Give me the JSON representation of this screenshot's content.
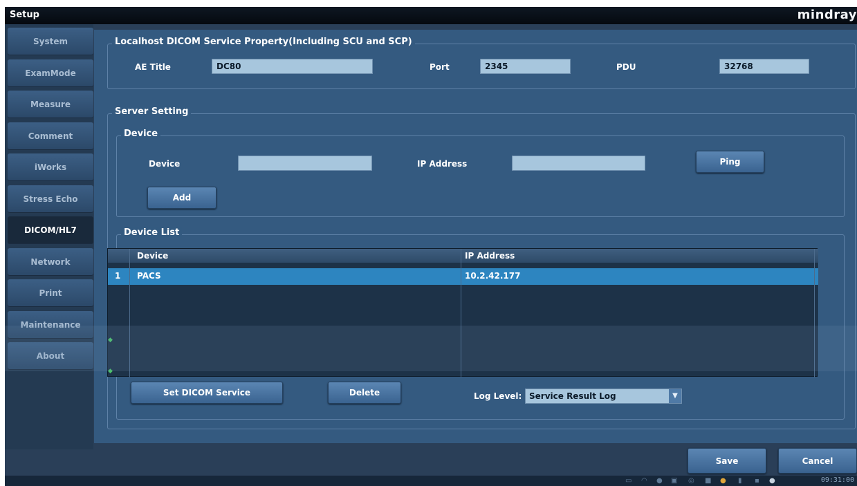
{
  "titlebar": {
    "title": "Setup",
    "brand": "mindray"
  },
  "sidebar": {
    "items": [
      {
        "label": "System"
      },
      {
        "label": "ExamMode"
      },
      {
        "label": "Measure"
      },
      {
        "label": "Comment"
      },
      {
        "label": "iWorks"
      },
      {
        "label": "Stress Echo"
      },
      {
        "label": "DICOM/HL7"
      },
      {
        "label": "Network"
      },
      {
        "label": "Print"
      },
      {
        "label": "Maintenance"
      },
      {
        "label": "About"
      }
    ],
    "active": "DICOM/HL7"
  },
  "localhost": {
    "legend": "Localhost DICOM Service Property(Including SCU and SCP)",
    "ae_title_label": "AE Title",
    "ae_title_value": "DC80",
    "port_label": "Port",
    "port_value": "2345",
    "pdu_label": "PDU",
    "pdu_value": "32768"
  },
  "server": {
    "legend": "Server Setting",
    "device_box": {
      "legend": "Device",
      "device_label": "Device",
      "device_value": "",
      "ip_label": "IP Address",
      "ip_value": "",
      "ping_label": "Ping",
      "add_label": "Add"
    },
    "device_list": {
      "legend": "Device List",
      "columns": [
        "Device",
        "IP Address"
      ],
      "rows": [
        {
          "index": "1",
          "device": "PACS",
          "ip": "10.2.42.177"
        }
      ]
    },
    "set_dicom_label": "Set DICOM Service",
    "delete_label": "Delete",
    "log_level_label": "Log Level:",
    "log_level_value": "Service Result Log"
  },
  "footer": {
    "save_label": "Save",
    "cancel_label": "Cancel",
    "clock": "09:31:00"
  },
  "colors": {
    "panel": "#345a80",
    "selected_row": "#2d85c0",
    "field": "#a7c6dd",
    "sidebar_active": "#19293b"
  }
}
